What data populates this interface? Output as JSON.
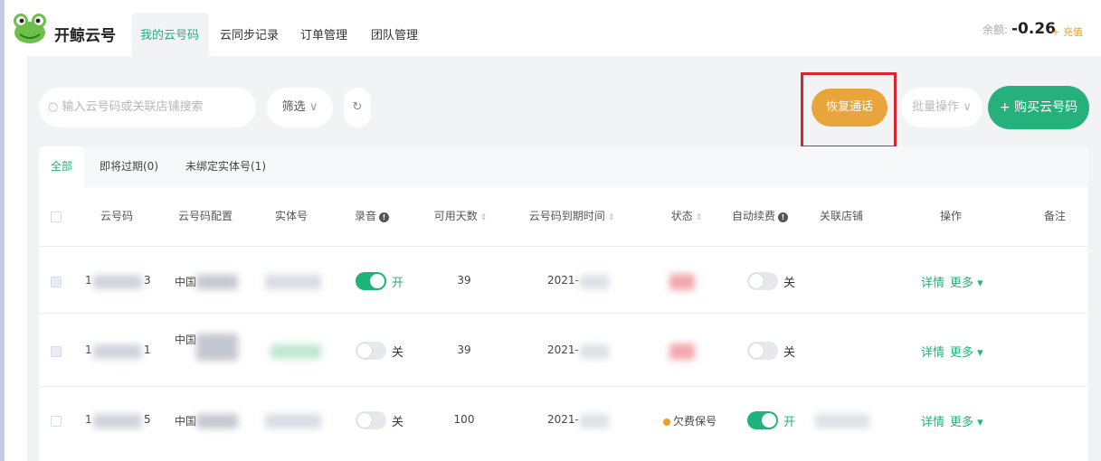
{
  "brand": {
    "name": "开鲸云号"
  },
  "nav": {
    "tabs": [
      "我的云号码",
      "云同步记录",
      "订单管理",
      "团队管理"
    ]
  },
  "account": {
    "balance_label": "余额:",
    "balance_value": "-0.26",
    "recharge": "+ 充值"
  },
  "toolbar": {
    "search_placeholder": "输入云号码或关联店铺搜索",
    "filter_label": "筛选",
    "refresh_icon": "refresh-icon",
    "restore_label": "恢复通话",
    "batch_label": "批量操作",
    "buy_label": "+ 购买云号码"
  },
  "subtabs": [
    "全部",
    "即将过期(0)",
    "未绑定实体号(1)"
  ],
  "table": {
    "headers": [
      "云号码",
      "云号码配置",
      "实体号",
      "录音",
      "可用天数",
      "云号码到期时间",
      "状态",
      "自动续费",
      "关联店铺",
      "操作",
      "备注"
    ],
    "rows": [
      {
        "num_start": "1",
        "num_end": "3",
        "config": "中国",
        "record_on": true,
        "record_label": "开",
        "days": "39",
        "expire": "2021-",
        "status": "",
        "auto_on": false,
        "auto_label": "关",
        "detail": "详情",
        "more": "更多 ▾"
      },
      {
        "num_start": "1",
        "num_end": "1",
        "config": "中国",
        "record_on": false,
        "record_label": "关",
        "days": "39",
        "expire": "2021-",
        "status": "",
        "auto_on": false,
        "auto_label": "关",
        "detail": "详情",
        "more": "更多 ▾"
      },
      {
        "num_start": "1",
        "num_end": "5",
        "config": "中国",
        "record_on": false,
        "record_label": "关",
        "days": "100",
        "expire": "2021-",
        "status": "欠费保号",
        "auto_on": true,
        "auto_label": "开",
        "detail": "详情",
        "more": "更多 ▾"
      }
    ]
  },
  "colors": {
    "accent": "#1fb27a",
    "restore": "#e8a53c",
    "highlight": "#d9262c"
  }
}
